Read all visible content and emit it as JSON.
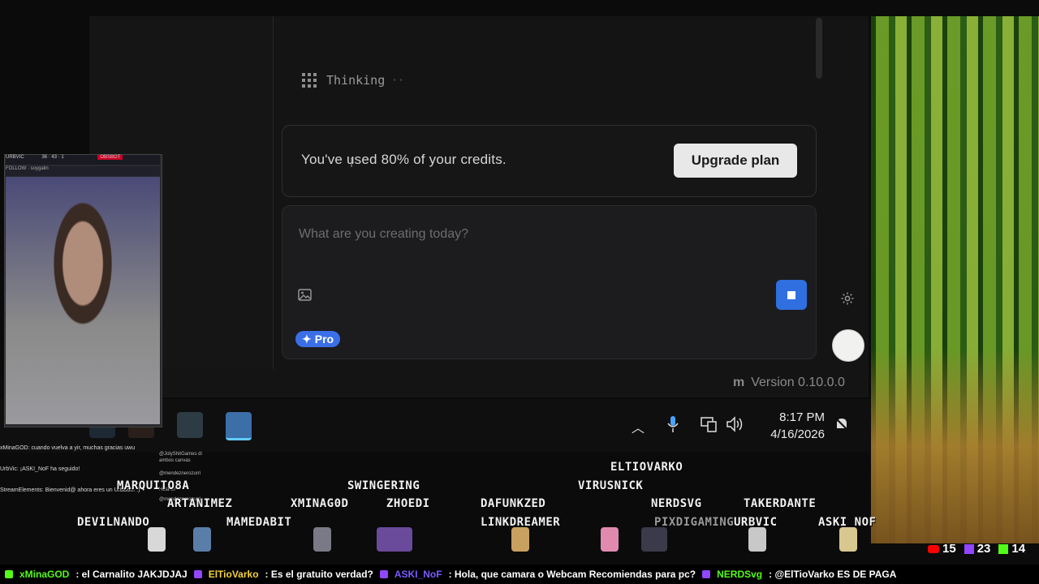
{
  "app": {
    "status": "Thinking",
    "status_dots": "··",
    "credits_message": "You've used 80% of your credits.",
    "upgrade_label": "Upgrade plan",
    "prompt_placeholder": "What are you creating today?",
    "pro_label": "Pro",
    "version_logo": "m",
    "version": "Version 0.10.0.0"
  },
  "taskbar": {
    "time": "8:17 PM",
    "date": "4/16/2026"
  },
  "webcam": {
    "header": "URBVIC",
    "stats": "36 · 43 · 1",
    "badge": "OBSBOT",
    "follow": "FOLLOW · soygalin"
  },
  "chat": {
    "lines": [
      "xMinaGOD: cuando vuelva a yir, muchas gracias uwu",
      "UrbVic: ¡ASKI_NoF ha seguido!",
      "StreamElements: Bienvenid@ ahora eres un UrbBot!! :)"
    ],
    "side": [
      "@JolyShitGames di ambos canvas",
      "@mendeznerozurri",
      "Hola Ur",
      "@mendeznerozurri"
    ]
  },
  "usernames": {
    "u1": "ELTIOVARKO",
    "u2": "SWINGERING",
    "u3": "VIRUSNICK",
    "u4": "MARQUITO8A",
    "u5": "ARTANIMEZ",
    "u6": "XMINAG0D",
    "u7": "ZHOEDI",
    "u8": "DAFUNKZED",
    "u9": "NERDSVG",
    "u10": "TAKERDANTE",
    "u11": "DEVILNANDO",
    "u12": "MAMEDABIT",
    "u13": "LINKDREAMER",
    "u14": "PIXDIGAMING",
    "u15": "URBVIC",
    "u16": "ASKI_NOF"
  },
  "counters": {
    "youtube": "15",
    "twitch": "23",
    "kick": "14"
  },
  "ticker": {
    "u1": "xMinaGOD",
    "m1": ": el Carnalito JAKJDJAJ",
    "u2": "ElTioVarko",
    "m2": ": Es el gratuito verdad?",
    "u3": "ASKI_NoF",
    "m3": ": Hola, que camara o Webcam Recomiendas para pc?",
    "u4": "NERDSvg",
    "m4": ": @ElTioVarko ES DE PAGA"
  },
  "colors": {
    "accent_blue": "#2f6fe0",
    "pro_blue": "#3a6fe8",
    "youtube": "#ff0000",
    "twitch": "#9146ff",
    "kick": "#53fc18"
  },
  "icons": [
    "grid-icon",
    "image-icon",
    "stop-icon",
    "sparkle-icon",
    "gear-icon",
    "avatar",
    "chevron-up-icon",
    "microphone-icon",
    "network-icon",
    "volume-icon",
    "notification-icon"
  ]
}
